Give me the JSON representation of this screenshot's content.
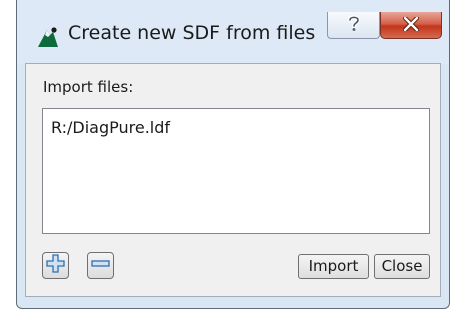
{
  "window": {
    "title": "Create new SDF from files",
    "help_glyph": "?",
    "close_glyph": "X",
    "icon": "mountain-logo-icon"
  },
  "import": {
    "label": "Import files:",
    "files": [
      "R:/DiagPure.ldf"
    ]
  },
  "buttons": {
    "add_icon": "plus-icon",
    "remove_icon": "minus-icon",
    "import_label": "Import",
    "close_label": "Close"
  },
  "colors": {
    "frame": "#d9e6f3",
    "close_button": "#c9452d",
    "icon_accent": "#2f6fb0"
  }
}
